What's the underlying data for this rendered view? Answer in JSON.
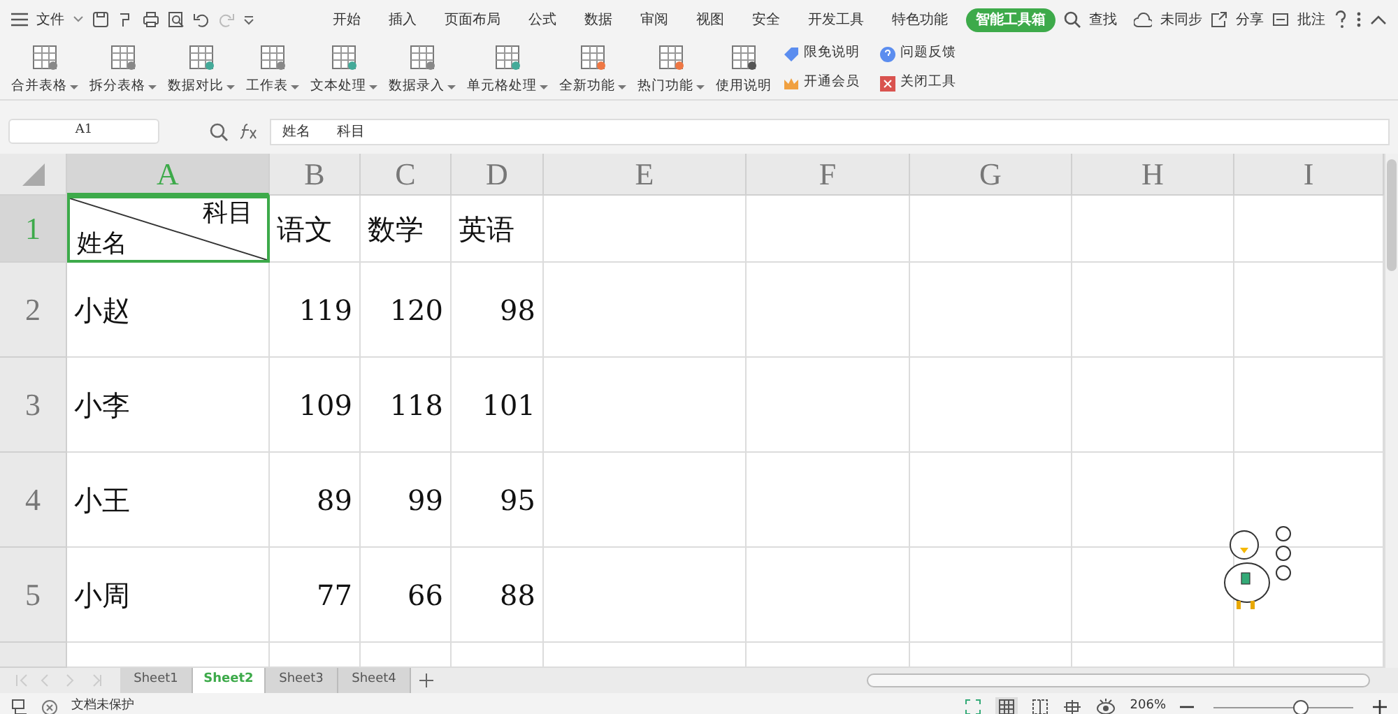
{
  "menu": {
    "file_label": "文件",
    "tabs": [
      {
        "label": "开始",
        "selected": false
      },
      {
        "label": "插入",
        "selected": false
      },
      {
        "label": "页面布局",
        "selected": false
      },
      {
        "label": "公式",
        "selected": false
      },
      {
        "label": "数据",
        "selected": false
      },
      {
        "label": "审阅",
        "selected": false
      },
      {
        "label": "视图",
        "selected": false
      },
      {
        "label": "安全",
        "selected": false
      },
      {
        "label": "开发工具",
        "selected": false
      },
      {
        "label": "特色功能",
        "selected": false
      },
      {
        "label": "智能工具箱",
        "selected": true
      }
    ],
    "search_label": "查找",
    "sync_label": "未同步",
    "share_label": "分享",
    "comment_label": "批注"
  },
  "ribbon": {
    "tools": [
      {
        "label": "合并表格",
        "dropdown": true
      },
      {
        "label": "拆分表格",
        "dropdown": true
      },
      {
        "label": "数据对比",
        "dropdown": true
      },
      {
        "label": "工作表",
        "dropdown": true
      },
      {
        "label": "文本处理",
        "dropdown": true
      },
      {
        "label": "数据录入",
        "dropdown": true
      },
      {
        "label": "单元格处理",
        "dropdown": true
      },
      {
        "label": "全新功能",
        "dropdown": true
      },
      {
        "label": "热门功能",
        "dropdown": true
      },
      {
        "label": "使用说明",
        "dropdown": false
      }
    ],
    "small_tools": [
      {
        "label": "限免说明",
        "kind": "tag"
      },
      {
        "label": "开通会员",
        "kind": "crown"
      },
      {
        "label": "问题反馈",
        "kind": "help"
      },
      {
        "label": "关闭工具",
        "kind": "close"
      }
    ]
  },
  "formula_bar": {
    "name_box": "A1",
    "value": "姓名      科目"
  },
  "sheet": {
    "columns": [
      {
        "label": "A",
        "selected": true
      },
      {
        "label": "B",
        "selected": false
      },
      {
        "label": "C",
        "selected": false
      },
      {
        "label": "D",
        "selected": false
      },
      {
        "label": "E",
        "selected": false
      },
      {
        "label": "F",
        "selected": false
      },
      {
        "label": "G",
        "selected": false
      },
      {
        "label": "H",
        "selected": false
      },
      {
        "label": "I",
        "selected": false
      }
    ],
    "rows": [
      {
        "number": "1",
        "selected": true,
        "kind": "header",
        "diagonal": {
          "top": "科目",
          "bottom": "姓名"
        },
        "cells": [
          "语文",
          "数学",
          "英语"
        ]
      },
      {
        "number": "2",
        "selected": false,
        "kind": "data",
        "cells": [
          "小赵",
          "119",
          "120",
          "98"
        ]
      },
      {
        "number": "3",
        "selected": false,
        "kind": "data",
        "cells": [
          "小李",
          "109",
          "118",
          "101"
        ]
      },
      {
        "number": "4",
        "selected": false,
        "kind": "data",
        "cells": [
          "小王",
          "89",
          "99",
          "95"
        ]
      },
      {
        "number": "5",
        "selected": false,
        "kind": "data",
        "cells": [
          "小周",
          "77",
          "66",
          "88"
        ]
      }
    ]
  },
  "sheet_tabs": [
    {
      "label": "Sheet1",
      "selected": false
    },
    {
      "label": "Sheet2",
      "selected": true
    },
    {
      "label": "Sheet3",
      "selected": false
    },
    {
      "label": "Sheet4",
      "selected": false
    }
  ],
  "status_bar": {
    "protection": "文档未保护",
    "zoom": "206%",
    "zoom_slider": {
      "level": 0.62
    }
  }
}
